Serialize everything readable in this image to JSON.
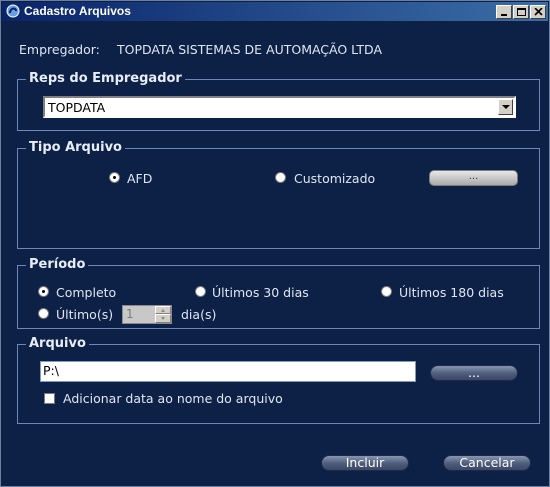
{
  "window": {
    "title": "Cadastro Arquivos",
    "controls": [
      "minimize",
      "maximize",
      "close"
    ]
  },
  "empregador": {
    "label": "Empregador:",
    "value": "TOPDATA SISTEMAS DE AUTOMAÇÃO LTDA"
  },
  "reps": {
    "title": "Reps do Empregador",
    "selected": "TOPDATA"
  },
  "tipo_arquivo": {
    "title": "Tipo Arquivo",
    "options": [
      "AFD",
      "Customizado"
    ],
    "selected": "AFD",
    "browse_label": "..."
  },
  "periodo": {
    "title": "Período",
    "options": [
      "Completo",
      "Últimos 30 dias",
      "Últimos 180 dias",
      "Último(s)"
    ],
    "selected": "Completo",
    "ultimos_value": "1",
    "dias_label": "dia(s)"
  },
  "arquivo": {
    "title": "Arquivo",
    "path_value": "P:\\",
    "browse_label": "...",
    "add_date_label": "Adicionar data ao nome do arquivo",
    "add_date_checked": false
  },
  "buttons": {
    "incluir": "Incluir",
    "cancelar": "Cancelar"
  },
  "colors": {
    "background": "#0d2146",
    "title_bar_start": "#0a246a",
    "title_bar_end": "#3a6ea5",
    "group_border": "#6f87b8"
  }
}
